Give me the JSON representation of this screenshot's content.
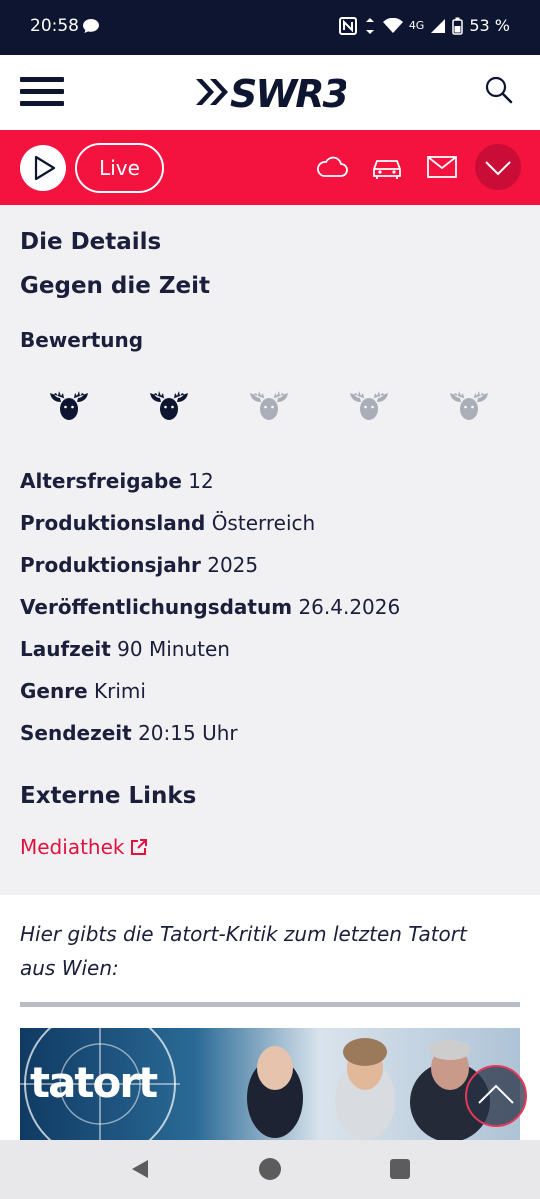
{
  "status_bar": {
    "time": "20:58",
    "network": "4G",
    "battery": "53 %"
  },
  "header": {
    "logo_text": "SWR3",
    "menu_icon": "hamburger-icon",
    "search_icon": "search-icon"
  },
  "player_bar": {
    "live_label": "Live",
    "icons": [
      "play-icon",
      "cloud-icon",
      "car-icon",
      "mail-icon",
      "chevron-down-icon"
    ],
    "accent_color": "#f4123f"
  },
  "details": {
    "heading": "Die Details",
    "title": "Gegen die Zeit",
    "rating_label": "Bewertung",
    "rating_value": 2,
    "rating_max": 5,
    "rows": [
      {
        "label": "Altersfreigabe",
        "value": "12"
      },
      {
        "label": "Produktionsland",
        "value": "Österreich"
      },
      {
        "label": "Produktionsjahr",
        "value": "2025"
      },
      {
        "label": "Veröffentlichungsdatum",
        "value": "26.4.2026"
      },
      {
        "label": "Laufzeit",
        "value": "90 Minuten"
      },
      {
        "label": "Genre",
        "value": "Krimi"
      },
      {
        "label": "Sendezeit",
        "value": "20:15 Uhr"
      }
    ]
  },
  "external_links": {
    "heading": "Externe Links",
    "mediathek": "Mediathek"
  },
  "teaser": {
    "text": "Hier gibts die Tatort-Kritik zum letzten Tatort aus Wien:",
    "image_brand": "tatort"
  }
}
